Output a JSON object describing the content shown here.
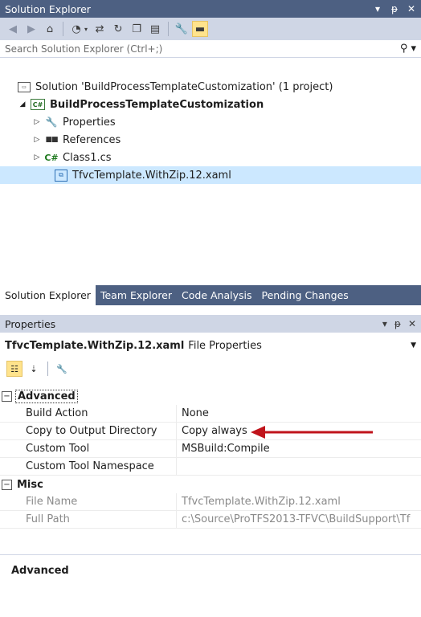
{
  "solution_explorer": {
    "title": "Solution Explorer",
    "title_controls": [
      "▾",
      "ᵖ",
      "✕"
    ],
    "search_placeholder": "Search Solution Explorer (Ctrl+;)",
    "search_icon": "search-icon",
    "tree": [
      {
        "label": "Solution 'BuildProcessTemplateCustomization' (1 project)",
        "icon": "solution-icon",
        "level": 0,
        "arrow": ""
      },
      {
        "label": "BuildProcessTemplateCustomization",
        "icon": "csharp-project-icon",
        "level": 1,
        "arrow": "◢",
        "bold": true
      },
      {
        "label": "Properties",
        "icon": "wrench-icon",
        "level": 2,
        "arrow": "▷"
      },
      {
        "label": "References",
        "icon": "references-icon",
        "level": 2,
        "arrow": "▷"
      },
      {
        "label": "Class1.cs",
        "icon": "csharp-file-icon",
        "level": 2,
        "arrow": "▷"
      },
      {
        "label": "TfvcTemplate.WithZip.12.xaml",
        "icon": "xaml-file-icon",
        "level": 2,
        "arrow": "",
        "selected": true
      }
    ]
  },
  "tabs": [
    {
      "label": "Solution Explorer",
      "active": true
    },
    {
      "label": "Team Explorer",
      "active": false
    },
    {
      "label": "Code Analysis",
      "active": false
    },
    {
      "label": "Pending Changes",
      "active": false
    }
  ],
  "properties": {
    "title": "Properties",
    "object_name": "TfvcTemplate.WithZip.12.xaml",
    "object_type": "File Properties",
    "categories": [
      {
        "label": "Advanced",
        "toggle": "⊟",
        "items": [
          {
            "name": "Build Action",
            "value": "None"
          },
          {
            "name": "Copy to Output Directory",
            "value": "Copy always"
          },
          {
            "name": "Custom Tool",
            "value": "MSBuild:Compile"
          },
          {
            "name": "Custom Tool Namespace",
            "value": ""
          }
        ]
      },
      {
        "label": "Misc",
        "toggle": "⊟",
        "items": [
          {
            "name": "File Name",
            "value": "TfvcTemplate.WithZip.12.xaml",
            "readonly": true
          },
          {
            "name": "Full Path",
            "value": "c:\\Source\\ProTFS2013-TFVC\\BuildSupport\\Tf",
            "readonly": true
          }
        ]
      }
    ],
    "description_title": "Advanced"
  },
  "colors": {
    "title_bar": "#4d6082",
    "toolbar": "#cfd6e5",
    "selection": "#cce8ff",
    "annotation_arrow": "#c0141b"
  }
}
